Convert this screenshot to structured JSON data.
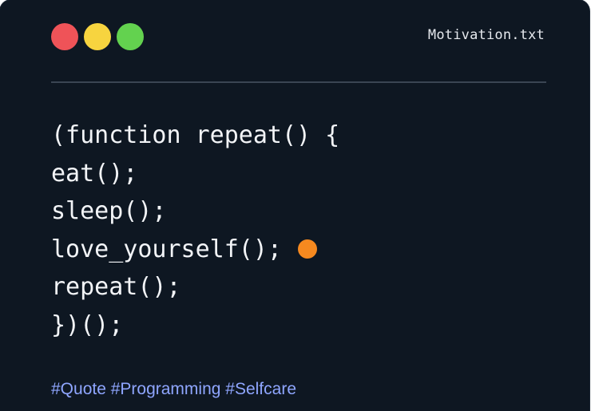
{
  "window": {
    "controls": [
      {
        "name": "close",
        "color": "#ef5358"
      },
      {
        "name": "minimize",
        "color": "#f7d43f"
      },
      {
        "name": "maximize",
        "color": "#63d24f"
      }
    ],
    "filename": "Motivation.txt",
    "background_color": "#0e1722"
  },
  "code": {
    "lines": [
      "(function repeat() {",
      "eat();",
      "sleep();",
      "love_yourself();",
      "repeat();",
      "})();"
    ],
    "marker_color": "#f6891f"
  },
  "footer": {
    "hashtags": "#Quote #Programming #Selfcare",
    "color": "#8fa6ff"
  }
}
